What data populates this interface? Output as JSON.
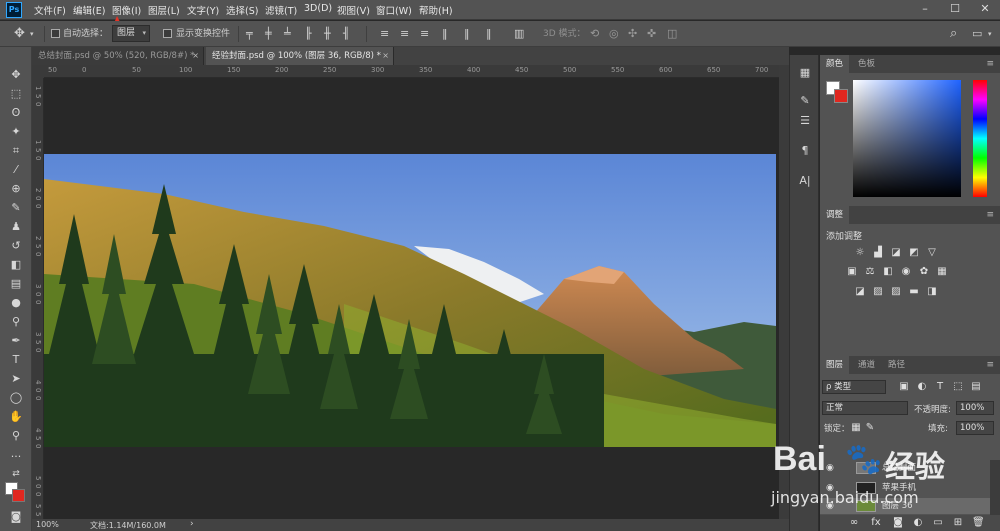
{
  "app": {
    "logo": "Ps"
  },
  "menu": [
    "文件(F)",
    "编辑(E)",
    "图像(I)",
    "图层(L)",
    "文字(Y)",
    "选择(S)",
    "滤镜(T)",
    "3D(D)",
    "视图(V)",
    "窗口(W)",
    "帮助(H)"
  ],
  "window_controls": {
    "minimize": "–",
    "maximize": "☐",
    "close": "✕"
  },
  "options": {
    "auto_select_label": "自动选择：",
    "layer_select": "图层",
    "show_transform_label": "显示变换控件",
    "mode_3d_label": "3D 模式："
  },
  "tabs": [
    {
      "label": "总结封面.psd @ 50% (520, RGB/8#) *",
      "close": "×"
    },
    {
      "label": "经验封面.psd @ 100% (图层 36, RGB/8) *",
      "close": "×"
    }
  ],
  "ruler_top": [
    "50",
    "0",
    "50",
    "100",
    "150",
    "200",
    "250",
    "300",
    "350",
    "400",
    "450",
    "500",
    "550",
    "600",
    "650",
    "700"
  ],
  "ruler_left": [
    "1",
    "5",
    "0",
    "1",
    "5",
    "0",
    "2",
    "0",
    "0",
    "2",
    "5",
    "0",
    "3",
    "0",
    "0",
    "3",
    "5",
    "0",
    "4",
    "0",
    "0",
    "4",
    "5",
    "0",
    "5",
    "0",
    "0",
    "5",
    "5"
  ],
  "status": {
    "zoom": "100%",
    "doc": "文档:1.14M/160.0M"
  },
  "color_panel": {
    "tabs": [
      "颜色",
      "色板"
    ],
    "fg": "#ffffff",
    "bg": "#e0271f"
  },
  "adjust_panel": {
    "tabs": [
      "调整"
    ],
    "title": "添加调整"
  },
  "layers_panel": {
    "tabs": [
      "图层",
      "通道",
      "路径"
    ],
    "kind_filter": "ρ 类型",
    "blend_mode": "正常",
    "opacity_label": "不透明度:",
    "opacity": "100%",
    "lock_label": "锁定：",
    "fill_label": "填充:",
    "fill": "100%",
    "layers": [
      {
        "name": "总结封面"
      },
      {
        "name": "苹果手机"
      },
      {
        "name": "图层 36"
      }
    ]
  },
  "watermark": {
    "brand": "Bai",
    "paw": "du",
    "suffix": "经验",
    "url": "jingyan.baidu.com"
  },
  "colors": {
    "accent": "#e0271f",
    "ps_blue": "#31a8ff"
  }
}
